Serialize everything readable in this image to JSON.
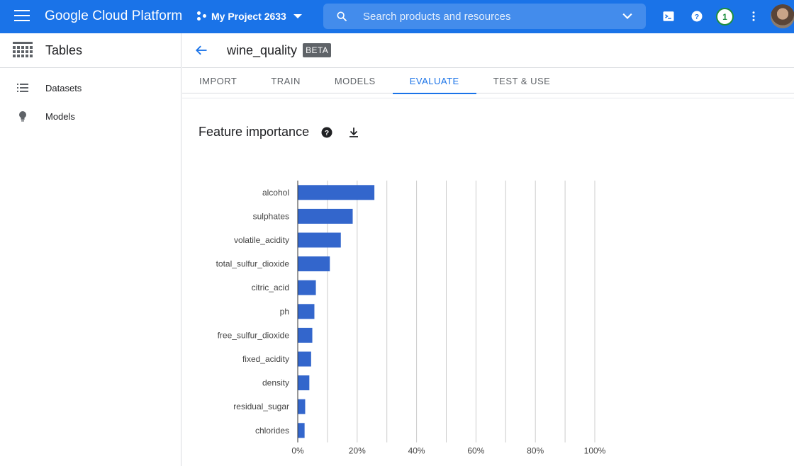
{
  "topbar": {
    "brand": "Google Cloud Platform",
    "project_name": "My Project 2633",
    "search_placeholder": "Search products and resources",
    "notification_count": "1",
    "accent_color": "#1a73e8"
  },
  "sidebar": {
    "title": "Tables",
    "items": [
      {
        "label": "Datasets",
        "icon": "list-icon"
      },
      {
        "label": "Models",
        "icon": "lightbulb-icon"
      }
    ]
  },
  "page": {
    "name": "wine_quality",
    "badge": "BETA",
    "tabs": [
      {
        "label": "IMPORT",
        "active": false
      },
      {
        "label": "TRAIN",
        "active": false
      },
      {
        "label": "MODELS",
        "active": false
      },
      {
        "label": "EVALUATE",
        "active": true
      },
      {
        "label": "TEST & USE",
        "active": false
      }
    ],
    "section_title": "Feature importance"
  },
  "chart_data": {
    "type": "bar",
    "orientation": "horizontal",
    "categories": [
      "alcohol",
      "sulphates",
      "volatile_acidity",
      "total_sulfur_dioxide",
      "citric_acid",
      "ph",
      "free_sulfur_dioxide",
      "fixed_acidity",
      "density",
      "residual_sugar",
      "chlorides"
    ],
    "values": [
      25.8,
      18.5,
      14.5,
      10.8,
      6.1,
      5.6,
      4.9,
      4.5,
      3.9,
      2.5,
      2.3
    ],
    "xlim": [
      0,
      100
    ],
    "xticks": [
      "0%",
      "20%",
      "40%",
      "60%",
      "80%",
      "100%"
    ],
    "grid": true,
    "bar_color": "#3366cc"
  }
}
